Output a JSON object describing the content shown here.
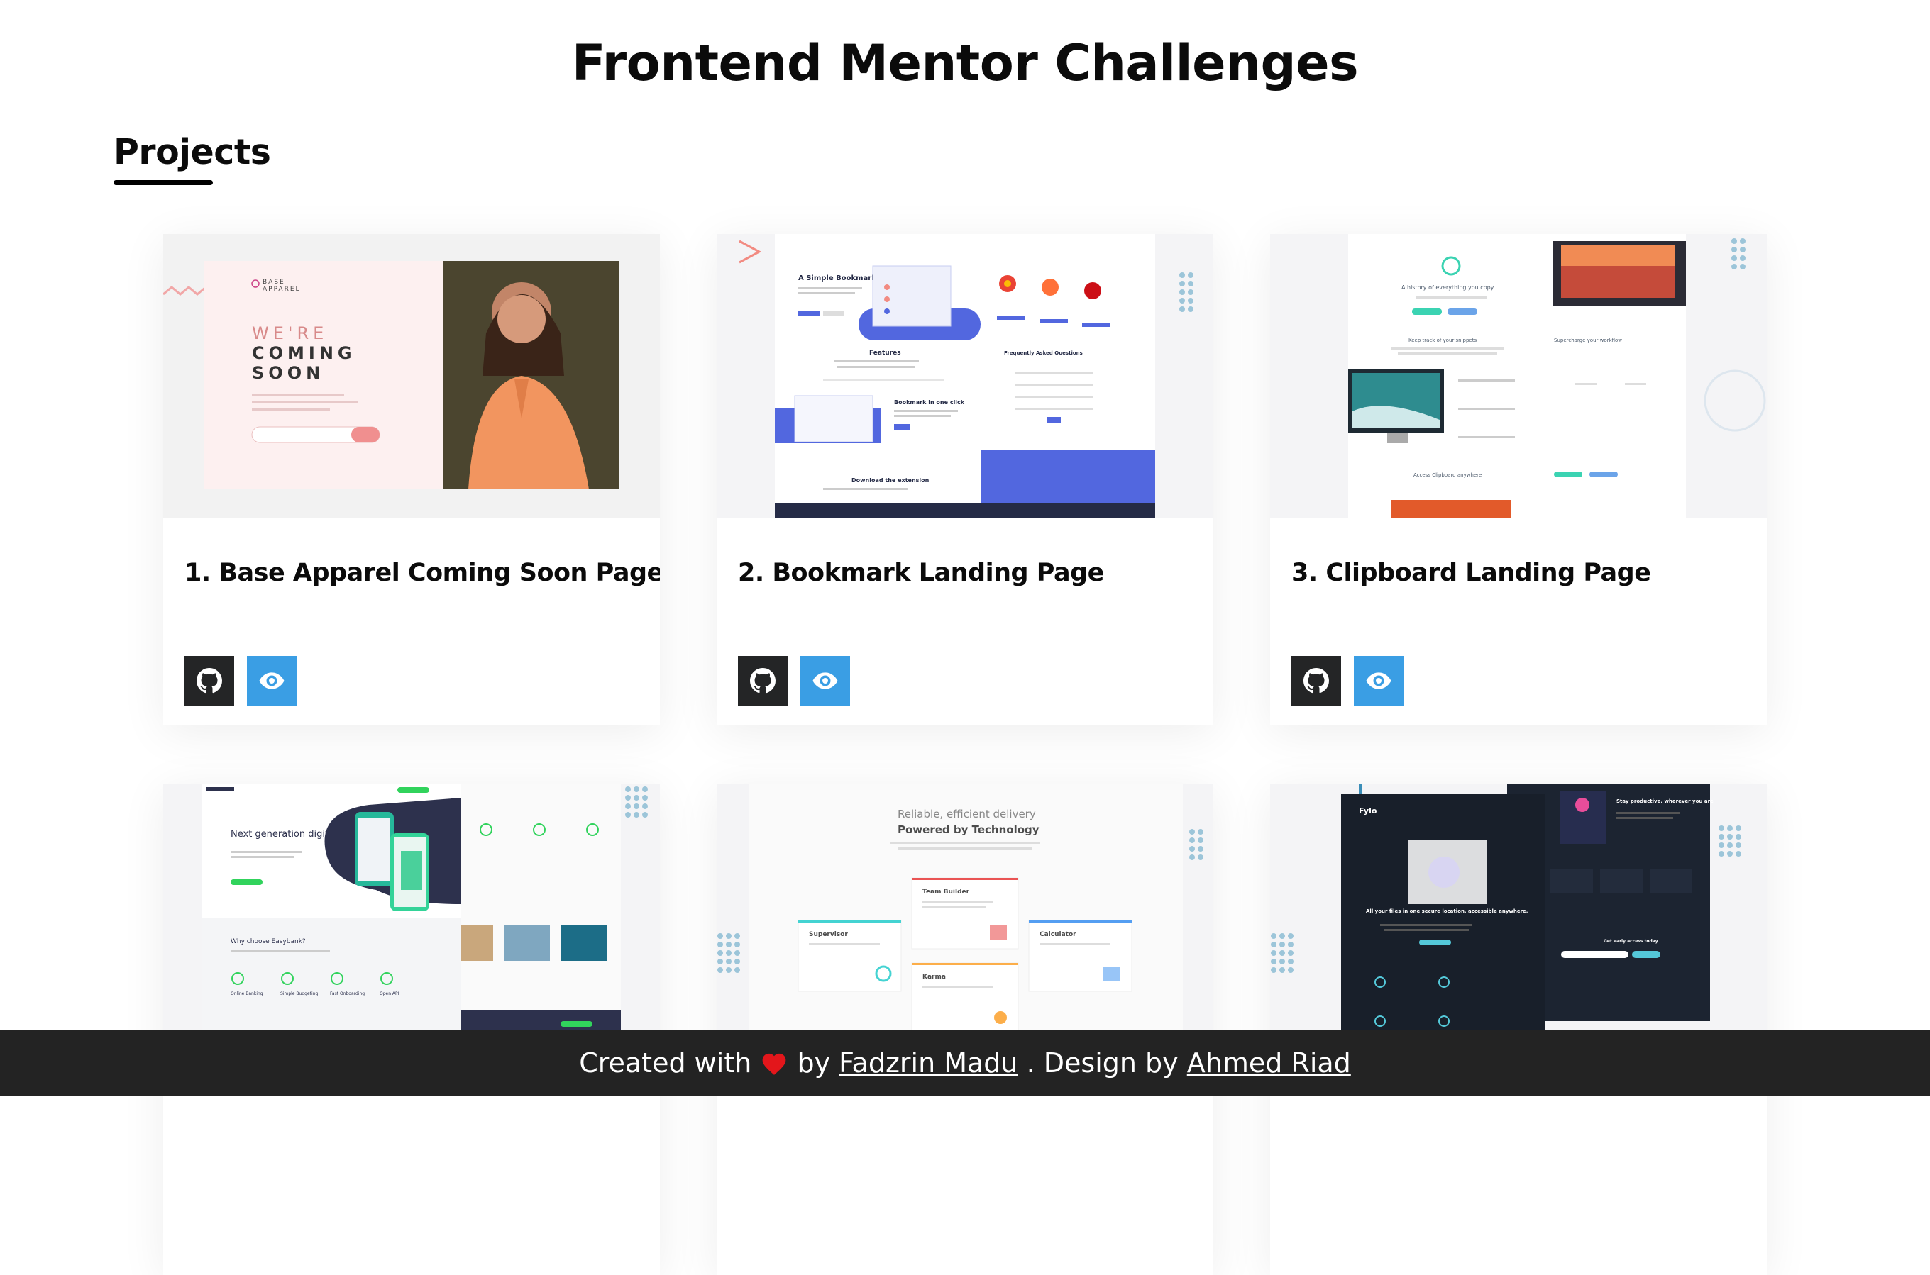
{
  "page": {
    "title": "Frontend Mentor Challenges",
    "section_title": "Projects"
  },
  "projects": [
    {
      "title": "1. Base Apparel Coming Soon Page",
      "thumb_text": [
        "BASE",
        "APPAREL",
        "WE'RE",
        "COMING",
        "SOON"
      ]
    },
    {
      "title": "2. Bookmark Landing Page",
      "thumb_text": [
        "A Simple Bookmark Manager",
        "Features",
        "Bookmark in one click",
        "Download the extension",
        "Frequently Asked Questions"
      ]
    },
    {
      "title": "3. Clipboard Landing Page",
      "thumb_text": [
        "A history of everything you copy",
        "Keep track of your snippets",
        "Supercharge your workflow",
        "Access Clipboard anywhere"
      ]
    },
    {
      "title": "",
      "thumb_text": [
        "Next generation digital banking",
        "Why choose Easybank?",
        "Online Banking",
        "Simple Budgeting",
        "Fast Onboarding",
        "Open API"
      ]
    },
    {
      "title": "",
      "thumb_text": [
        "Reliable, efficient delivery",
        "Powered by Technology",
        "Team Builder",
        "Supervisor",
        "Calculator",
        "Karma"
      ]
    },
    {
      "title": "",
      "thumb_text": [
        "Fylo",
        "All your files in one secure location, accessible anywhere.",
        "Stay productive, wherever you are",
        "Get early access today"
      ]
    }
  ],
  "buttons": {
    "github_icon": "github-icon",
    "live_icon": "eye-icon"
  },
  "footer": {
    "created_with": "Created with",
    "by": "by",
    "author": "Fadzrin Madu",
    "design_by": ". Design by",
    "designer": "Ahmed Riad"
  },
  "colors": {
    "accent": "#3a9ee4",
    "dark_button": "#242526",
    "footer_bg": "#232323",
    "heart": "#e3161b"
  }
}
